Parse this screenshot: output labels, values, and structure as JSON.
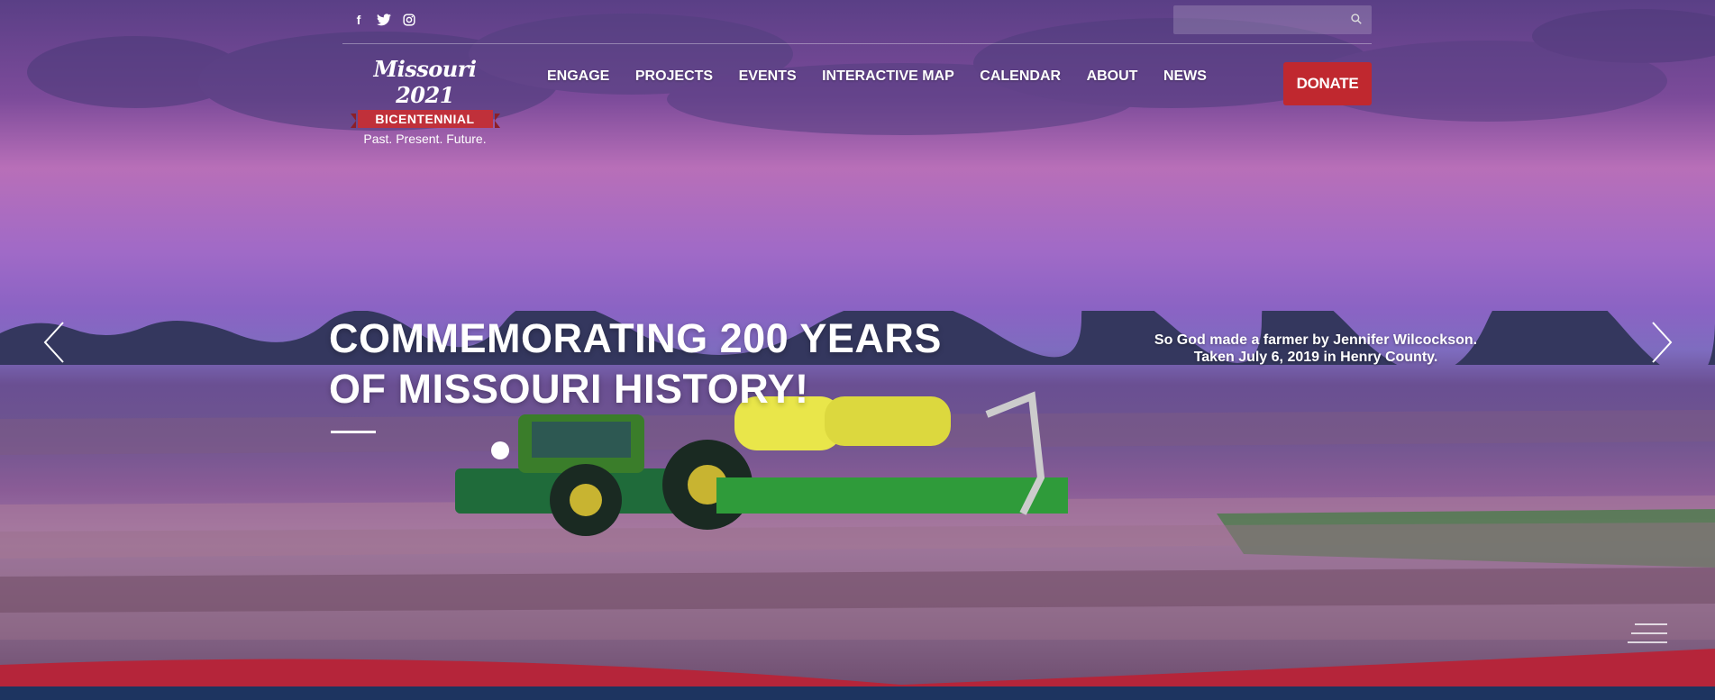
{
  "social": {
    "facebook": "f",
    "twitter": "twitter-icon",
    "instagram": "instagram-icon"
  },
  "search": {
    "placeholder": ""
  },
  "logo": {
    "script": "Missouri 2021",
    "ribbon": "BICENTENNIAL",
    "tagline": "Past. Present. Future."
  },
  "nav": {
    "items": [
      "ENGAGE",
      "PROJECTS",
      "EVENTS",
      "INTERACTIVE MAP",
      "CALENDAR",
      "ABOUT",
      "NEWS"
    ],
    "donate": "DONATE"
  },
  "hero": {
    "headline_line1": "COMMEMORATING 200 YEARS",
    "headline_line2": "OF MISSOURI HISTORY!",
    "caption_line1": "So God made a farmer by Jennifer Wilcockson.",
    "caption_line2": "Taken July 6, 2019 in Henry County."
  },
  "colors": {
    "accent_red": "#c0282f",
    "navy": "#1d3460"
  }
}
